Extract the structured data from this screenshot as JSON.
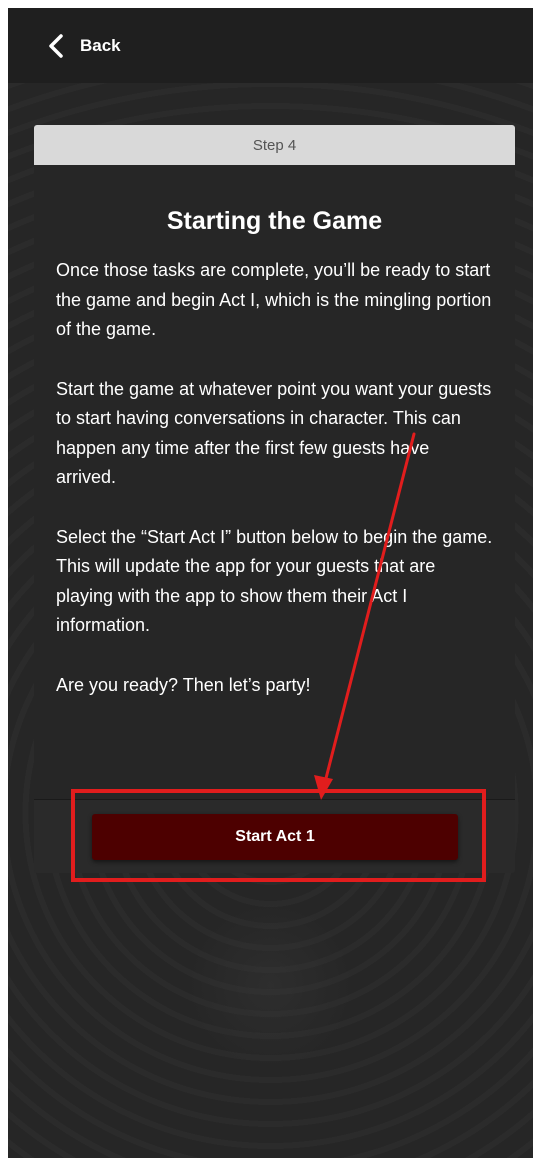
{
  "header": {
    "back_label": "Back",
    "back_icon": "chevron-left-icon"
  },
  "card": {
    "step_label": "Step 4",
    "title": "Starting the Game",
    "paragraphs": [
      "Once those tasks are complete, you’ll be ready to start the game and begin Act I, which is the mingling portion of the game.",
      "Start the game at whatever point you want your guests to start having conversations in character. This can happen any time after the first few guests have arrived.",
      "Select the “Start Act I” button below to begin the game. This will update the app for your guests that are playing with the app to show them their Act I information.",
      "Are you ready? Then let’s party!"
    ],
    "button_label": "Start Act 1"
  },
  "annotation": {
    "color": "#e11d1d"
  }
}
